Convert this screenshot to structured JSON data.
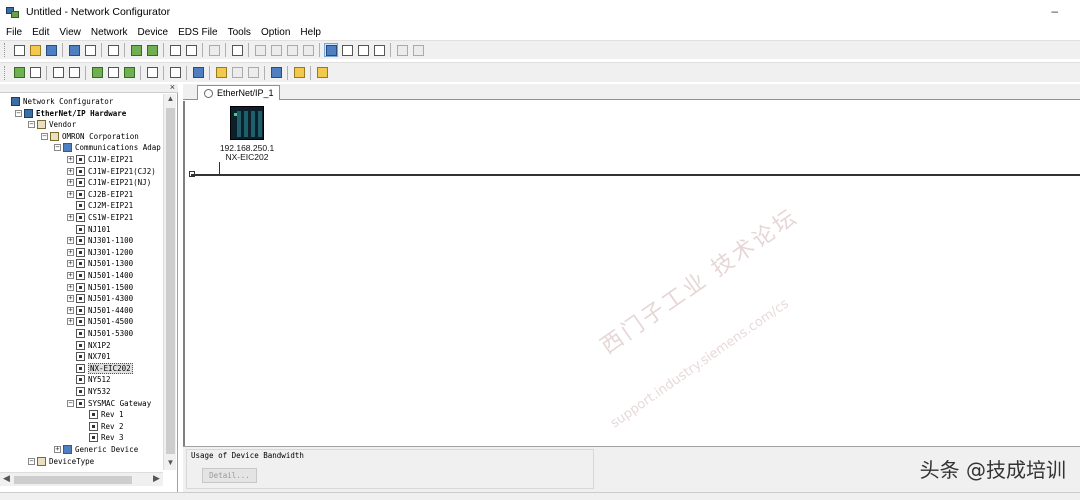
{
  "window": {
    "title": "Untitled - Network Configurator",
    "minimize_glyph": "–"
  },
  "menu": [
    "File",
    "Edit",
    "View",
    "Network",
    "Device",
    "EDS File",
    "Tools",
    "Option",
    "Help"
  ],
  "left_pane": {
    "close_glyph": "×",
    "tree": [
      {
        "label": "Network Configurator",
        "depth": 0,
        "icon": "network-configurator-icon",
        "expander": "",
        "bold": false
      },
      {
        "label": "EtherNet/IP Hardware",
        "depth": 1,
        "icon": "ethernet-ip-icon",
        "expander": "−",
        "bold": true
      },
      {
        "label": "Vendor",
        "depth": 2,
        "icon": "folder-icon",
        "expander": "−",
        "bold": false
      },
      {
        "label": "OMRON Corporation",
        "depth": 3,
        "icon": "folder-icon",
        "expander": "−",
        "bold": false
      },
      {
        "label": "Communications Adap",
        "depth": 4,
        "icon": "network-category-icon",
        "expander": "−",
        "bold": false
      },
      {
        "label": "CJ1W-EIP21",
        "depth": 5,
        "icon": "module-icon",
        "expander": "+",
        "bold": false
      },
      {
        "label": "CJ1W-EIP21(CJ2)",
        "depth": 5,
        "icon": "module-icon",
        "expander": "+",
        "bold": false
      },
      {
        "label": "CJ1W-EIP21(NJ)",
        "depth": 5,
        "icon": "module-icon",
        "expander": "+",
        "bold": false
      },
      {
        "label": "CJ2B-EIP21",
        "depth": 5,
        "icon": "module-icon",
        "expander": "+",
        "bold": false
      },
      {
        "label": "CJ2M-EIP21",
        "depth": 5,
        "icon": "module-icon",
        "expander": "",
        "bold": false
      },
      {
        "label": "CS1W-EIP21",
        "depth": 5,
        "icon": "module-icon",
        "expander": "+",
        "bold": false
      },
      {
        "label": "NJ101",
        "depth": 5,
        "icon": "module-icon",
        "expander": "",
        "bold": false
      },
      {
        "label": "NJ301-1100",
        "depth": 5,
        "icon": "module-icon",
        "expander": "+",
        "bold": false
      },
      {
        "label": "NJ301-1200",
        "depth": 5,
        "icon": "module-icon",
        "expander": "+",
        "bold": false
      },
      {
        "label": "NJ501-1300",
        "depth": 5,
        "icon": "module-icon",
        "expander": "+",
        "bold": false
      },
      {
        "label": "NJ501-1400",
        "depth": 5,
        "icon": "module-icon",
        "expander": "+",
        "bold": false
      },
      {
        "label": "NJ501-1500",
        "depth": 5,
        "icon": "module-icon",
        "expander": "+",
        "bold": false
      },
      {
        "label": "NJ501-4300",
        "depth": 5,
        "icon": "module-icon",
        "expander": "+",
        "bold": false
      },
      {
        "label": "NJ501-4400",
        "depth": 5,
        "icon": "module-icon",
        "expander": "+",
        "bold": false
      },
      {
        "label": "NJ501-4500",
        "depth": 5,
        "icon": "module-icon",
        "expander": "+",
        "bold": false
      },
      {
        "label": "NJ501-5300",
        "depth": 5,
        "icon": "module-icon",
        "expander": "",
        "bold": false
      },
      {
        "label": "NX1P2",
        "depth": 5,
        "icon": "module-icon",
        "expander": "",
        "bold": false
      },
      {
        "label": "NX701",
        "depth": 5,
        "icon": "module-icon",
        "expander": "",
        "bold": false
      },
      {
        "label": "NX-EIC202",
        "depth": 5,
        "icon": "module-icon",
        "expander": "",
        "bold": false,
        "selected": true
      },
      {
        "label": "NY512",
        "depth": 5,
        "icon": "module-icon",
        "expander": "",
        "bold": false
      },
      {
        "label": "NY532",
        "depth": 5,
        "icon": "module-icon",
        "expander": "",
        "bold": false
      },
      {
        "label": "SYSMAC Gateway",
        "depth": 5,
        "icon": "module-icon",
        "expander": "−",
        "bold": false
      },
      {
        "label": "Rev 1",
        "depth": 6,
        "icon": "module-icon",
        "expander": "",
        "bold": false
      },
      {
        "label": "Rev 2",
        "depth": 6,
        "icon": "module-icon",
        "expander": "",
        "bold": false
      },
      {
        "label": "Rev 3",
        "depth": 6,
        "icon": "module-icon",
        "expander": "",
        "bold": false
      },
      {
        "label": "Generic Device",
        "depth": 4,
        "icon": "network-category-icon",
        "expander": "+",
        "bold": false
      },
      {
        "label": "DeviceType",
        "depth": 2,
        "icon": "folder-icon",
        "expander": "−",
        "bold": false
      }
    ]
  },
  "tab": {
    "label": "EtherNet/IP_1"
  },
  "device": {
    "ip": "192.168.250.1",
    "name": "NX-EIC202"
  },
  "watermark": {
    "text": "西门子工业 技术论坛",
    "url": "support.industry.siemens.com/cs"
  },
  "bottom": {
    "bandwidth_label": "Usage of Device Bandwidth",
    "detail_label": "Detail...",
    "credit": "头条 @技成培训"
  },
  "icons": {
    "toolbar1": [
      "new-file-icon",
      "open-folder-icon",
      "save-icon",
      "sep",
      "network-icon",
      "network-alt-icon",
      "sep",
      "wand-icon",
      "sep",
      "connect-icon",
      "disconnect-icon",
      "sep",
      "upload-icon",
      "download-icon",
      "sep",
      "compare-icon",
      "sep",
      "print-icon",
      "sep",
      "cut-icon",
      "copy-icon",
      "paste-icon",
      "delete-icon",
      "sep",
      "large-icon-view-icon",
      "small-icon-view-icon",
      "list-view-icon",
      "detail-view-icon",
      "sep",
      "zoom-in-icon",
      "zoom-out-icon"
    ],
    "toolbar2": [
      "monitor-icon",
      "status-icon",
      "sep",
      "parameter-icon",
      "parameter-edit-icon",
      "sep",
      "connection-icon",
      "register-icon",
      "check-icon",
      "sep",
      "table-icon",
      "sep",
      "network-view-icon",
      "sep",
      "bandwidth-icon",
      "sep",
      "install-eds-icon",
      "delete-eds-icon",
      "export-eds-icon",
      "sep",
      "device-list-icon",
      "sep",
      "find-icon",
      "sep",
      "property-icon"
    ]
  }
}
